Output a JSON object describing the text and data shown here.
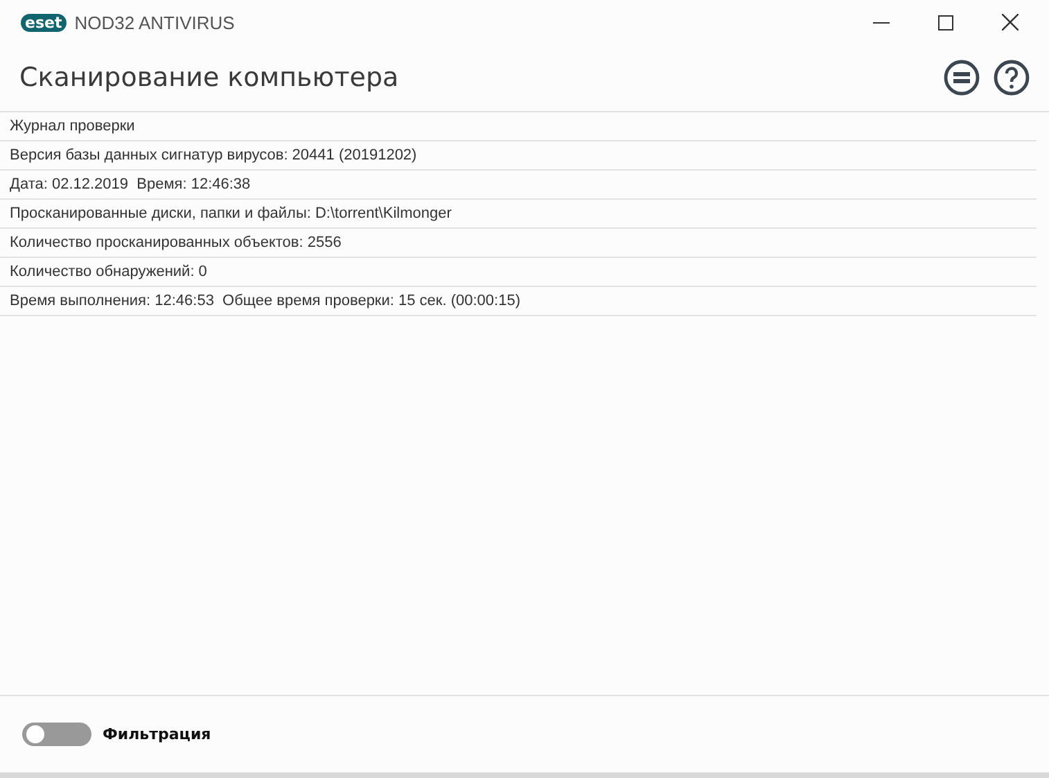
{
  "window": {
    "logo": "eset",
    "title": "NOD32 ANTIVIRUS"
  },
  "header": {
    "title": "Сканирование компьютера"
  },
  "log_lines": [
    "Журнал проверки",
    "Версия базы данных сигнатур вирусов: 20441 (20191202)",
    "Дата: 02.12.2019  Время: 12:46:38",
    "Просканированные диски, папки и файлы: D:\\torrent\\Kilmonger",
    "Количество просканированных объектов: 2556",
    "Количество обнаружений: 0",
    "Время выполнения: 12:46:53  Общее время проверки: 15 сек. (00:00:15)"
  ],
  "filter": {
    "label": "Фильтрация",
    "on": false
  }
}
